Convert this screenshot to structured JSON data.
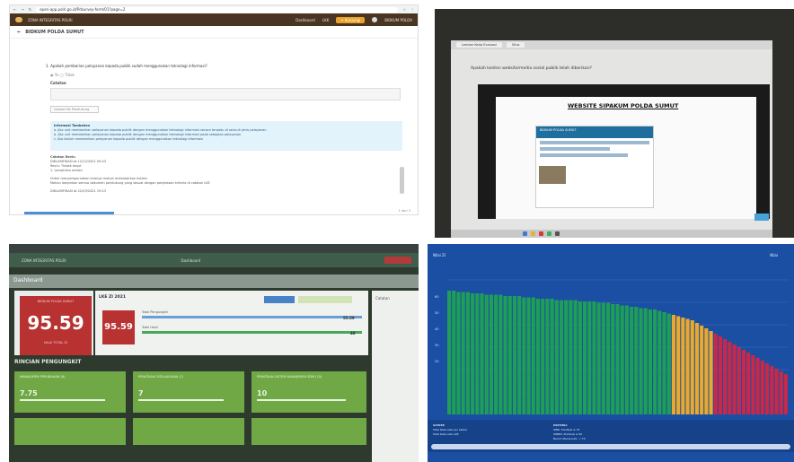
{
  "panel1": {
    "url": "eperi-app.polri.go.id/Pdsurvey-form/01?page=2",
    "app_title": "ZONA INTEGRITAS POLRI",
    "nav_dashboard": "Dashboard",
    "nav_lkk": "LKK",
    "nav_button": "+ Kunjungi",
    "user": "BIDKUM POLDA",
    "breadcrumb": "BIDKUM POLDA SUMUT",
    "question": "1. Apakah pemberian pelayanan kepada publik sudah menggunakan teknologi informasi?",
    "options": "◉ Ya   ◯ Tidak",
    "catatan_label": "Catatan",
    "upload_btn": "Upload file Pendukung",
    "info_title": "Informasi Tambahan",
    "info_lines": [
      "a. Jika unit memberikan pelayanan kepada publik dengan menggunakan teknologi informasi secara terpadu di seluruh jenis pelayanan",
      "b. Jika unit memberikan pelayanan kepada publik dengan menggunakan teknologi informasi pada sebagian pelayanan",
      "c. Jika belum memberikan pelayanan kepada publik dengan menggunakan teknologi informasi"
    ],
    "notes_title": "Catatan Reviu",
    "notes_lines": [
      "DIKLARIFIKASI at 12/12/2021 09:43",
      "Reviu: Tindak lanjut",
      "1. Lampirkan eviden",
      "",
      "Untuk menyempurnakan kiranya mohon melampirkan eviden",
      "Mohon lampirkan semua dokumen pendukung yang sesuai dengan penjelasan kriteria di catatan LKE",
      "",
      "DIKLARIFIKASI at 22/03/2021 19:23"
    ],
    "pager": "1 dari 3"
  },
  "panel2": {
    "tab1": "Lembar Kerja Evaluasi",
    "tab2": "Situs",
    "question": "Apakah konten website/media sosial publik telah diberikan?",
    "site_title": "WEBSITE SIPAKUM POLDA SUMUT",
    "site_header": "BIDKUM POLDA SUMUT"
  },
  "panel3": {
    "app_title": "ZONA INTEGRITAS POLRI",
    "nav_center": "Dashboard",
    "page_title": "Dashboard",
    "left_card_label": "BIDKUM POLDA SUMUT",
    "left_score": "95.59",
    "left_card_sub": "NILAI TOTAL ZI",
    "mid_title": "LKE ZI 2021",
    "mid_score": "95.59",
    "bar1_label": "Total Pengungkit",
    "bar1_value": "55.59",
    "bar2_label": "Total Hasil",
    "bar2_value": "40",
    "right_title": "Catatan",
    "section": "RINCIAN PENGUNGKIT",
    "cards": [
      {
        "label": "MANAJEMEN PERUBAHAN (8)",
        "value": "7.75"
      },
      {
        "label": "PENATAAN TATALAKSANA (7)",
        "value": "7"
      },
      {
        "label": "PENATAAN SISTEM MANAJEMEN SDM (10)",
        "value": "10"
      }
    ]
  },
  "panel4": {
    "title": "Nilai ZI",
    "legend": "Nilai",
    "y_ticks": [
      "60",
      "50",
      "40",
      "30",
      "20"
    ],
    "footer_col1_title": "SATKER",
    "footer_col1": [
      "Total Rata-rata per satker",
      "Total Rata-rata LKE"
    ],
    "footer_col2_title": "KRITERIA",
    "footer_col2": [
      "WBK: Predikat ≥ 75",
      "WBBM: Predikat ≥ 85",
      "Belum Memenuhi: < 75"
    ]
  },
  "chart_data": {
    "type": "bar",
    "title": "Nilai ZI",
    "values": [
      92,
      92,
      91,
      91,
      91,
      90,
      90,
      90,
      89,
      89,
      89,
      89,
      88,
      88,
      88,
      88,
      87,
      87,
      87,
      86,
      86,
      86,
      86,
      85,
      85,
      85,
      85,
      85,
      84,
      84,
      84,
      84,
      83,
      83,
      83,
      82,
      82,
      81,
      81,
      80,
      80,
      79,
      79,
      78,
      78,
      77,
      76,
      75,
      74,
      73,
      72,
      71,
      70,
      68,
      66,
      64,
      62,
      60,
      58,
      56,
      54,
      52,
      50,
      48,
      46,
      44,
      42,
      40,
      38,
      36,
      34,
      32,
      30
    ],
    "colors": {
      "high": "#1e9e57",
      "mid": "#e8a92e",
      "low": "#c8284a"
    }
  }
}
